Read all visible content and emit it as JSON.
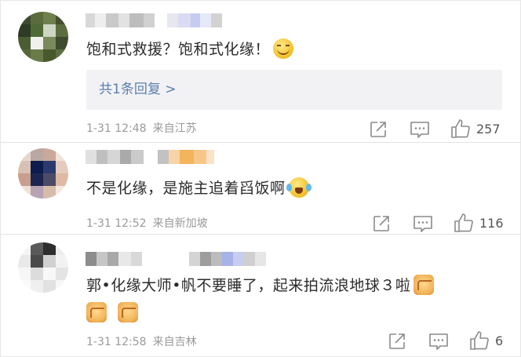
{
  "comments": [
    {
      "text": "饱和式救援？饱和式化缘！",
      "emojis": [
        "smile-emoji"
      ],
      "reply_label": "共1条回复 >",
      "date": "1-31 12:48",
      "source": "来自江苏",
      "likes": "257"
    },
    {
      "text": "不是化缘，是施主追着舀饭啊",
      "emojis": [
        "laugh-cry-emoji"
      ],
      "date": "1-31 12:52",
      "source": "来自新加坡",
      "likes": "116"
    },
    {
      "text": "郭•化缘大师•帆不要睡了，起来拍流浪地球３啦",
      "emojis": [
        "fist-emoji",
        "fist-emoji",
        "fist-emoji"
      ],
      "date": "1-31 12:58",
      "source": "来自吉林",
      "likes": "6"
    }
  ],
  "icons": {
    "share": "share-icon",
    "comment": "comment-icon",
    "like": "thumbs-up-icon"
  },
  "colors": {
    "meta_text": "#9a9a9a",
    "reply_link": "#5b7fb0",
    "reply_bg": "#f2f2f5",
    "icon_gray": "#8a8a8a"
  }
}
